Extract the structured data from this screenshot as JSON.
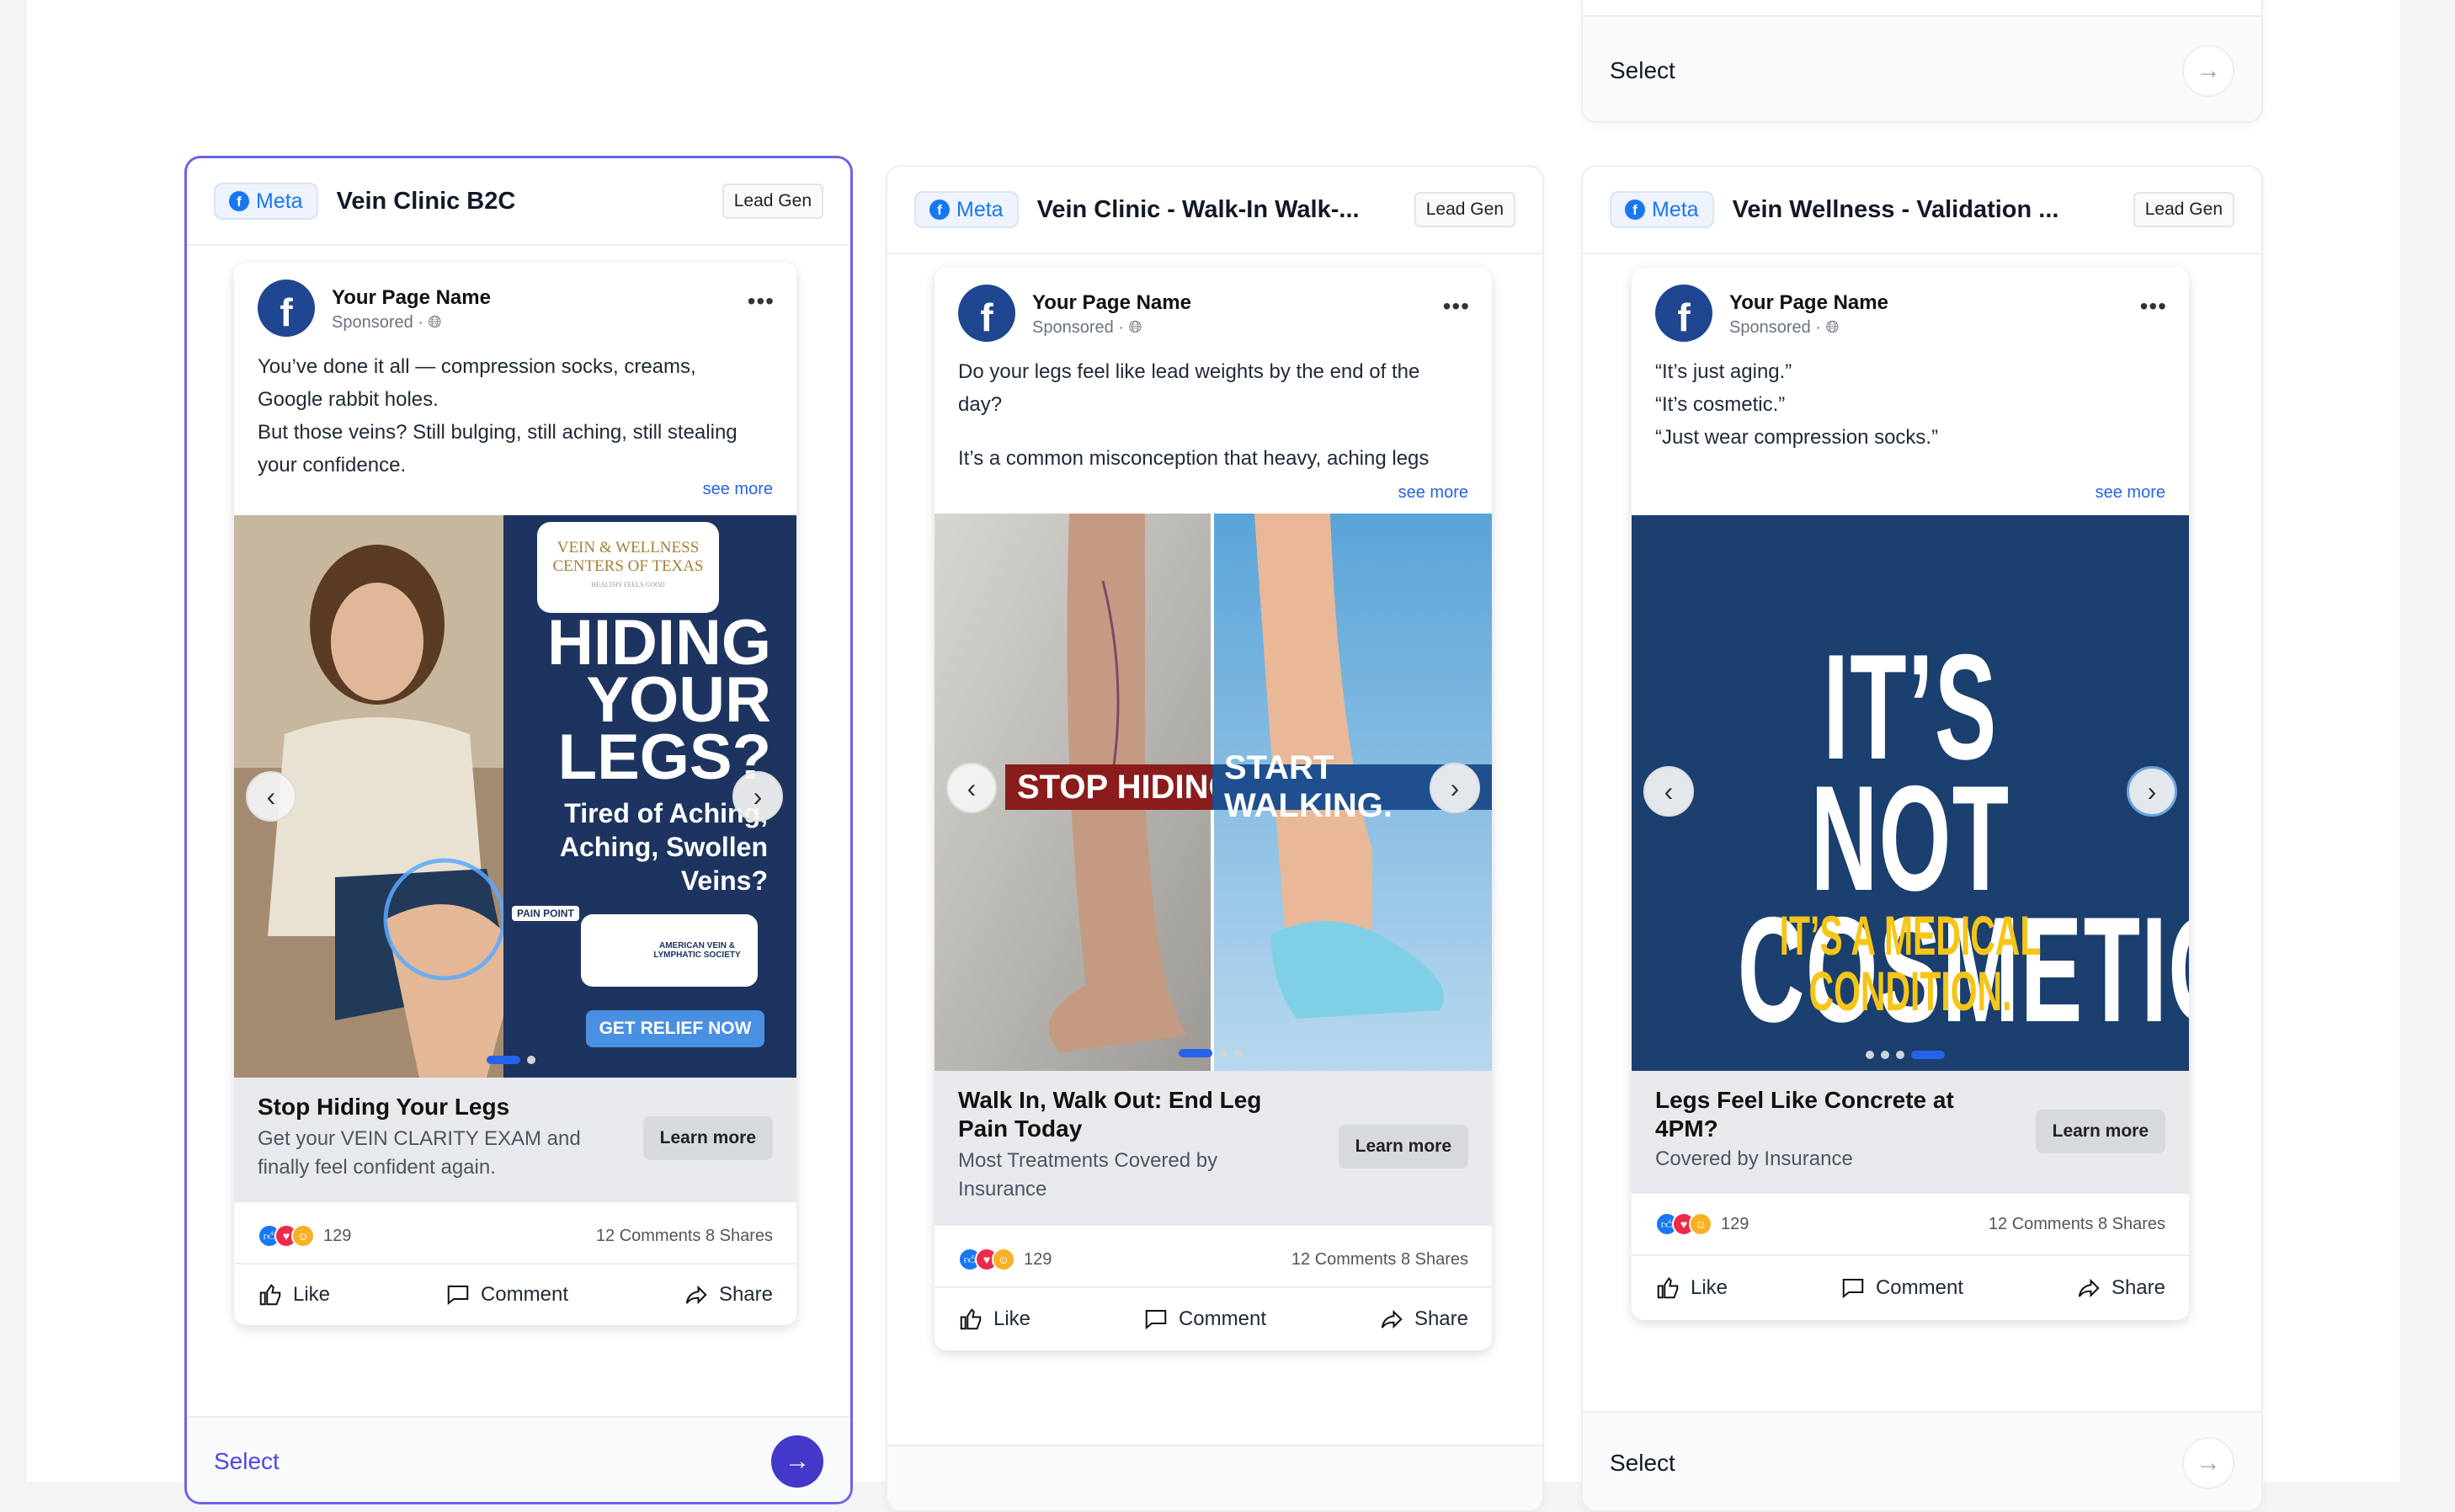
{
  "top_card": {
    "select_label": "Select"
  },
  "cards": [
    {
      "platform": "Meta",
      "title": "Vein Clinic B2C",
      "badge": "Lead Gen",
      "page_name": "Your Page Name",
      "sponsored": "Sponsored",
      "body": [
        "You’ve done it all — compression socks, creams,",
        "Google rabbit holes.",
        "But those veins? Still bulging, still aching, still stealing",
        "your confidence."
      ],
      "see_more": "see more",
      "ad": {
        "logo_line1": "VEIN & WELLNESS",
        "logo_line2": "CENTERS OF TEXAS",
        "logo_tag": "HEALTHY FEELS GOOD",
        "headline": [
          "HIDING",
          "YOUR",
          "LEGS?"
        ],
        "sub": [
          "Tired of Aching,",
          "Aching, Swollen",
          "Veins?"
        ],
        "pain_tag": "PAIN POINT",
        "society": "AMERICAN VEIN & LYMPHATIC SOCIETY",
        "cta": "GET RELIEF NOW"
      },
      "cta_title": "Stop Hiding Your Legs",
      "cta_desc": [
        "Get your VEIN CLARITY EXAM and",
        "finally feel confident again."
      ],
      "learn": "Learn more",
      "reactions": "129",
      "stats": "12 Comments 8 Shares",
      "actions": [
        "Like",
        "Comment",
        "Share"
      ],
      "select_label": "Select"
    },
    {
      "platform": "Meta",
      "title": "Vein Clinic - Walk-In Walk-...",
      "badge": "Lead Gen",
      "page_name": "Your Page Name",
      "sponsored": "Sponsored",
      "body": [
        "Do your legs feel like lead weights by the end of the",
        "day?",
        "",
        "It’s a common misconception that heavy, aching legs"
      ],
      "see_more": "see more",
      "ad": {
        "left": "STOP HIDING.",
        "right": "START WALKING."
      },
      "cta_title": [
        "Walk In, Walk Out: End Leg",
        "Pain Today"
      ],
      "cta_desc": [
        "Most Treatments Covered by",
        "Insurance"
      ],
      "learn": "Learn more",
      "reactions": "129",
      "stats": "12 Comments 8 Shares",
      "actions": [
        "Like",
        "Comment",
        "Share"
      ]
    },
    {
      "platform": "Meta",
      "title": "Vein Wellness - Validation ...",
      "badge": "Lead Gen",
      "page_name": "Your Page Name",
      "sponsored": "Sponsored",
      "body": [
        "“It’s just aging.”",
        "“It’s cosmetic.”",
        "“Just wear compression socks.”"
      ],
      "see_more": "see more",
      "ad": {
        "line1": "IT’S NOT",
        "line2": "COSMETIC.",
        "line3": "IT’S A MEDICAL CONDITION."
      },
      "cta_title": [
        "Legs Feel Like Concrete at",
        "4PM?"
      ],
      "cta_desc": [
        "Covered by Insurance"
      ],
      "learn": "Learn more",
      "reactions": "129",
      "stats": "12 Comments 8 Shares",
      "actions": [
        "Like",
        "Comment",
        "Share"
      ],
      "select_label": "Select"
    }
  ],
  "colors": {
    "accent": "#4f46e5",
    "facebook": "#1877f2",
    "ad_navy": "#1b3f6e",
    "ad_yellow": "#f5c518",
    "ad_red": "#8b1c1c"
  }
}
